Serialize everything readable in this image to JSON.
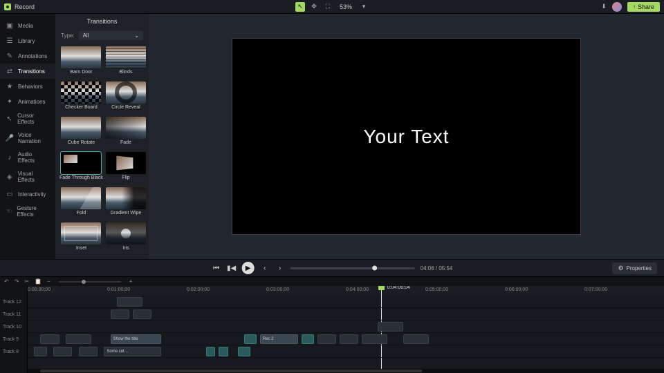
{
  "topbar": {
    "record": "Record",
    "zoom": "53%",
    "share": "Share"
  },
  "nav": {
    "items": [
      {
        "label": "Media",
        "icon": "▣"
      },
      {
        "label": "Library",
        "icon": "☰"
      },
      {
        "label": "Annotations",
        "icon": "✎"
      },
      {
        "label": "Transitions",
        "icon": "⇄"
      },
      {
        "label": "Behaviors",
        "icon": "★"
      },
      {
        "label": "Animations",
        "icon": "✦"
      },
      {
        "label": "Cursor Effects",
        "icon": "↖"
      },
      {
        "label": "Voice Narration",
        "icon": "🎤"
      },
      {
        "label": "Audio Effects",
        "icon": "♪"
      },
      {
        "label": "Visual Effects",
        "icon": "◈"
      },
      {
        "label": "Interactivity",
        "icon": "▭"
      },
      {
        "label": "Gesture Effects",
        "icon": "☜"
      }
    ],
    "active": 3
  },
  "panel": {
    "title": "Transitions",
    "typeLabel": "Type:",
    "typeValue": "All",
    "items": [
      {
        "name": "Barn Door",
        "cls": ""
      },
      {
        "name": "Blinds",
        "cls": "blinds"
      },
      {
        "name": "Checker Board",
        "cls": "checker"
      },
      {
        "name": "Circle Reveal",
        "cls": "circle"
      },
      {
        "name": "Cube Rotate",
        "cls": ""
      },
      {
        "name": "Fade",
        "cls": "fade"
      },
      {
        "name": "Fade Through Black",
        "cls": "black",
        "sel": true
      },
      {
        "name": "Flip",
        "cls": "flip"
      },
      {
        "name": "Fold",
        "cls": "fold"
      },
      {
        "name": "Gradient Wipe",
        "cls": "gwipe"
      },
      {
        "name": "Inset",
        "cls": "inset"
      },
      {
        "name": "Iris",
        "cls": "iris"
      }
    ]
  },
  "canvas": {
    "text": "Your Text"
  },
  "playbar": {
    "time": "04:06 / 05:54",
    "properties": "Properties"
  },
  "ruler": {
    "ticks": [
      "0:00:00;00",
      "0:01:00;00",
      "0:02:00;00",
      "0:03:00;00",
      "0:04:00;00",
      "0:05:00;00",
      "0:06:00;00",
      "0:07:00;00"
    ],
    "playhead": {
      "pct": 55.5,
      "label": "0:04:06;04"
    }
  },
  "tracks": {
    "labels": [
      "Track 12",
      "Track 11",
      "Track 10",
      "Track 9",
      "Track 8"
    ],
    "rows": [
      [
        {
          "l": 14,
          "w": 4,
          "cls": "dark tiny"
        }
      ],
      [
        {
          "l": 13,
          "w": 3,
          "cls": "dark tiny"
        },
        {
          "l": 16.5,
          "w": 3,
          "cls": "dark tiny"
        }
      ],
      [
        {
          "l": 55,
          "w": 4,
          "cls": "dark tiny"
        }
      ],
      [
        {
          "l": 2,
          "w": 3,
          "cls": "dark tiny"
        },
        {
          "l": 6,
          "w": 4,
          "cls": "dark tiny"
        },
        {
          "l": 13,
          "w": 8,
          "cls": "",
          "txt": "Show the title"
        },
        {
          "l": 34,
          "w": 2,
          "cls": "teal tiny"
        },
        {
          "l": 36.5,
          "w": 6,
          "cls": "",
          "txt": "Rec 2"
        },
        {
          "l": 43,
          "w": 2,
          "cls": "teal tiny"
        },
        {
          "l": 45.5,
          "w": 3,
          "cls": "dark tiny"
        },
        {
          "l": 49,
          "w": 3,
          "cls": "dark tiny"
        },
        {
          "l": 52.5,
          "w": 4,
          "cls": "dark tiny"
        },
        {
          "l": 59,
          "w": 4,
          "cls": "dark tiny"
        }
      ],
      [
        {
          "l": 1,
          "w": 2,
          "cls": "dark tiny"
        },
        {
          "l": 4,
          "w": 3,
          "cls": "dark tiny"
        },
        {
          "l": 8,
          "w": 3,
          "cls": "dark tiny"
        },
        {
          "l": 12,
          "w": 9,
          "cls": "dark",
          "txt": "Some col…"
        },
        {
          "l": 28,
          "w": 1.5,
          "cls": "teal tiny"
        },
        {
          "l": 30,
          "w": 1.5,
          "cls": "teal tiny"
        },
        {
          "l": 33,
          "w": 2,
          "cls": "teal tiny"
        }
      ]
    ]
  }
}
